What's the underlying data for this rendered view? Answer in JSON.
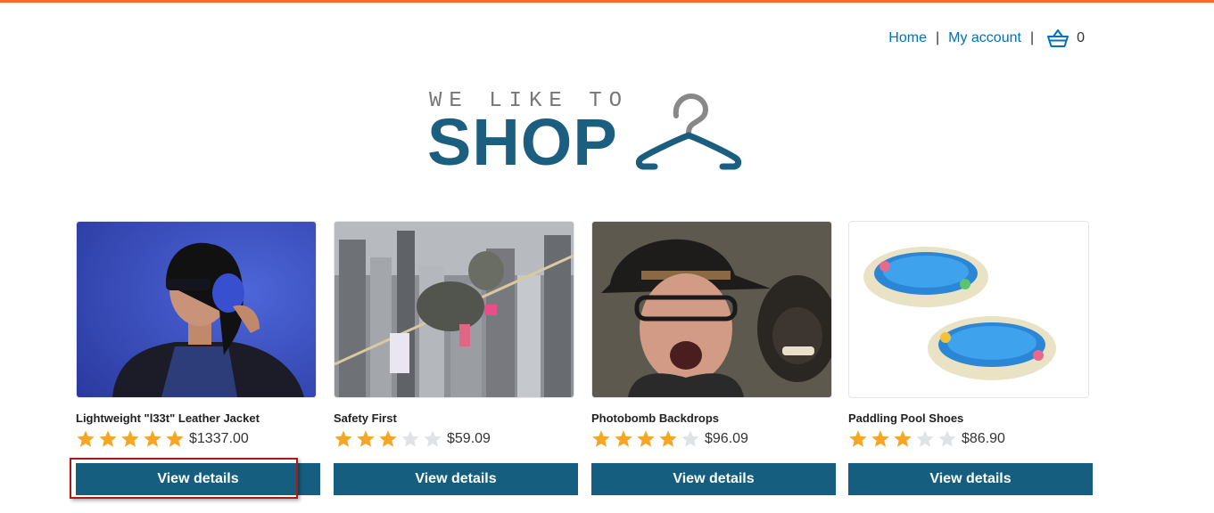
{
  "header": {
    "home_label": "Home",
    "separator_1": "|",
    "account_label": "My account",
    "separator_2": "|",
    "cart_icon": "shopping-basket-icon",
    "cart_count": "0"
  },
  "logo": {
    "top_text": "WE LIKE TO",
    "main_text": "SHOP",
    "icon": "hanger-icon"
  },
  "colors": {
    "accent_orange": "#ff6633",
    "brand_blue": "#155e80",
    "link_blue": "#0071bc",
    "star_gold": "#f5a623",
    "star_empty": "#e0e3e6"
  },
  "products": [
    {
      "name": "Lightweight \"l33t\" Leather Jacket",
      "rating": 5,
      "max_rating": 5,
      "price": "$1337.00",
      "button_label": "View details",
      "image": "woman-with-headphones-photo"
    },
    {
      "name": "Safety First",
      "rating": 3,
      "max_rating": 5,
      "price": "$59.09",
      "button_label": "View details",
      "image": "child-on-tightrope-photo"
    },
    {
      "name": "Photobomb Backdrops",
      "rating": 4,
      "max_rating": 5,
      "price": "$96.09",
      "button_label": "View details",
      "image": "man-and-monkey-photo"
    },
    {
      "name": "Paddling Pool Shoes",
      "rating": 3,
      "max_rating": 5,
      "price": "$86.90",
      "button_label": "View details",
      "image": "paddling-pools-photo"
    }
  ]
}
